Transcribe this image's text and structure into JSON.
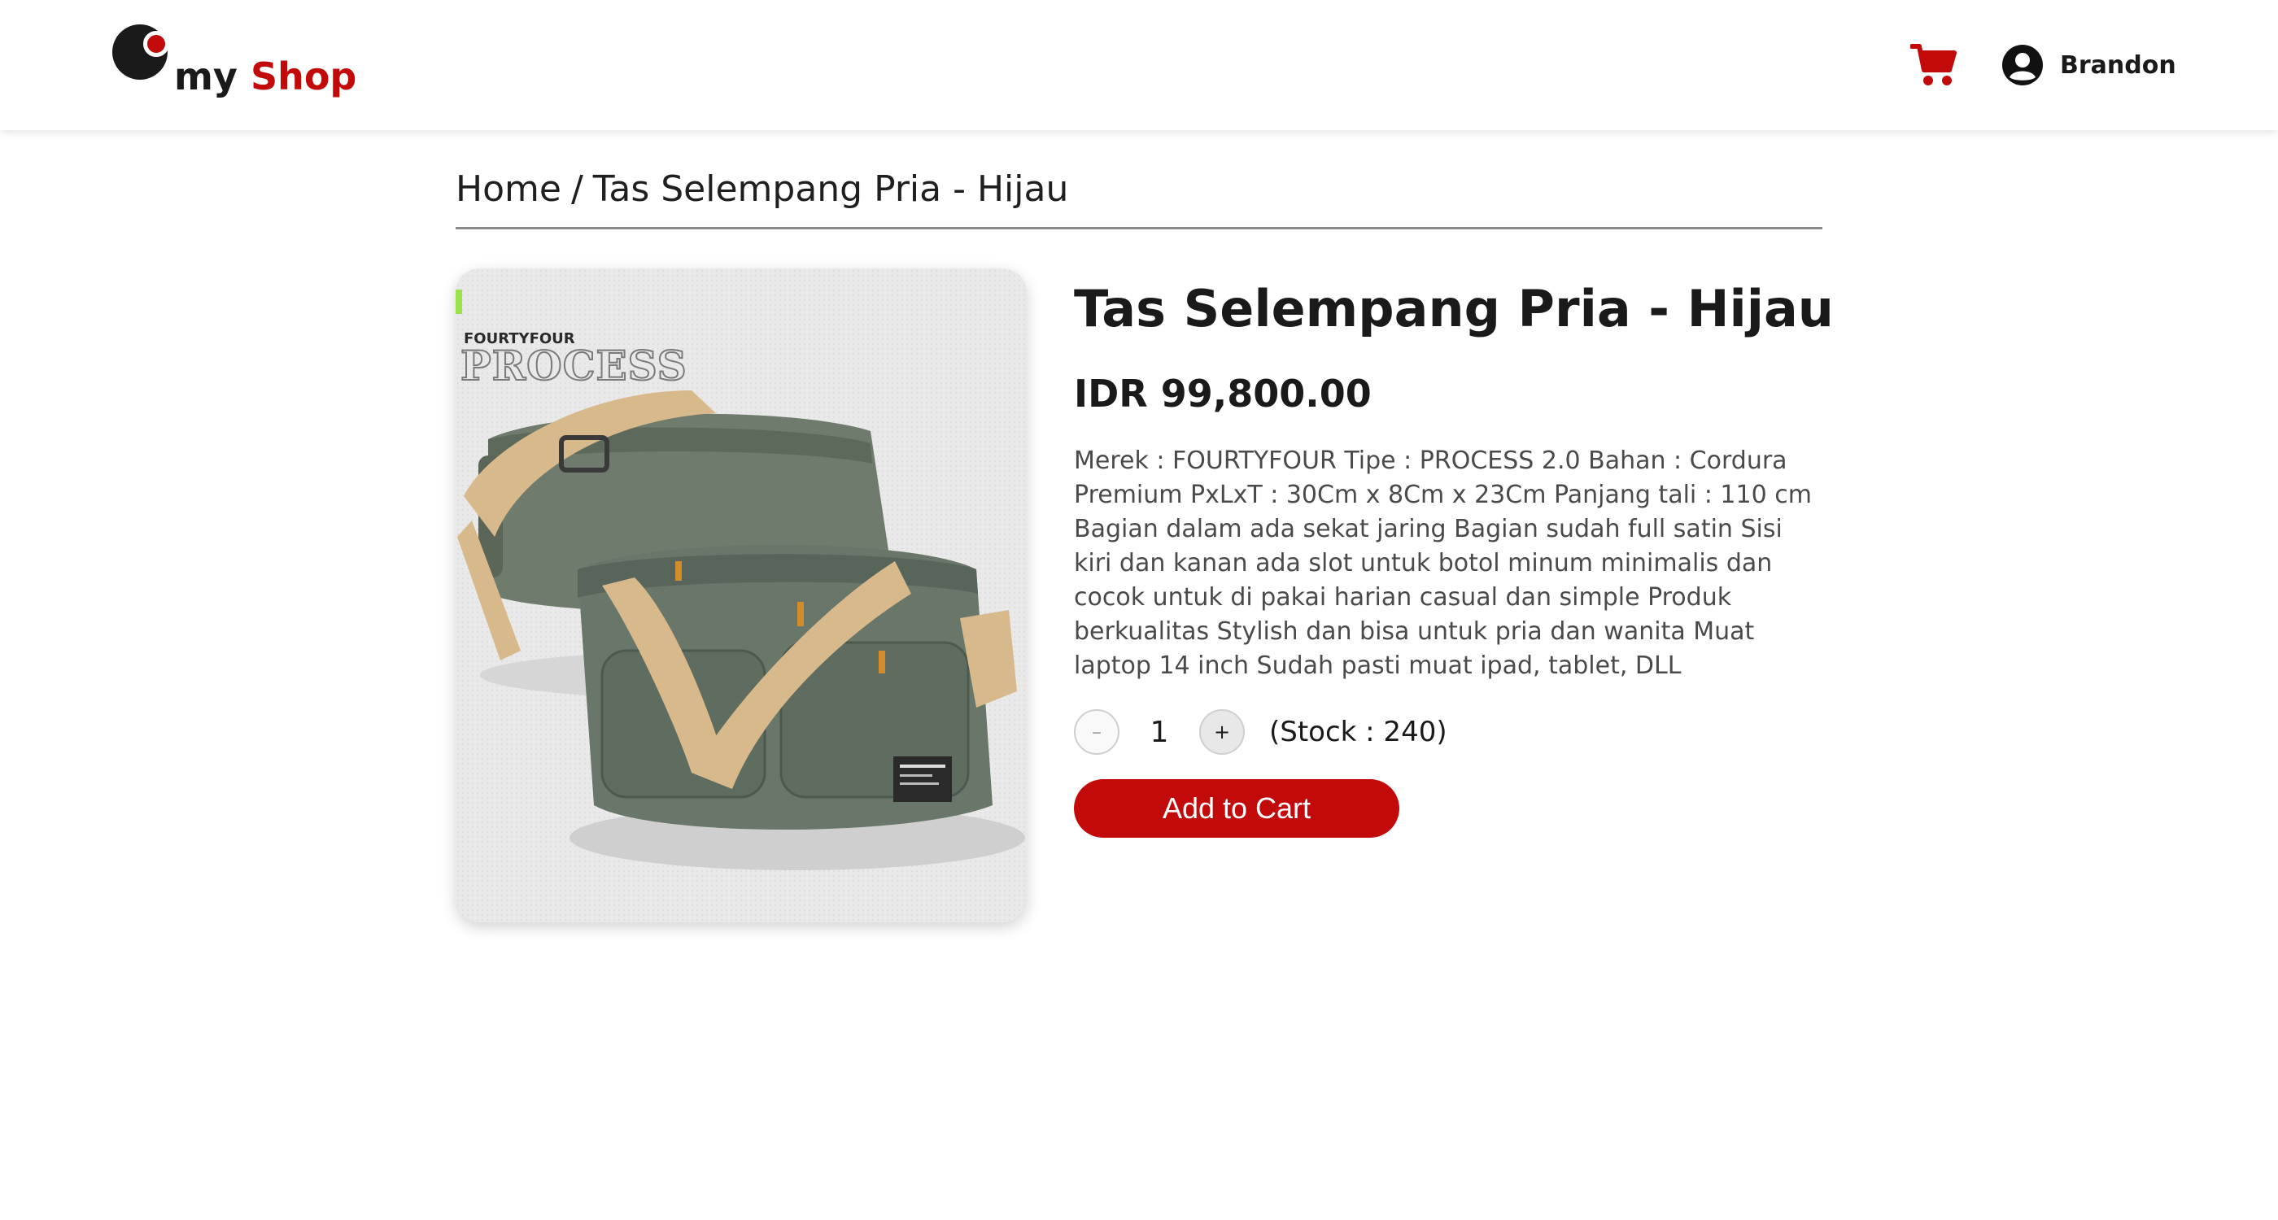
{
  "header": {
    "logo_my": "my",
    "logo_shop": "Shop",
    "cart_icon": "cart-icon",
    "user_icon": "user-circle-icon",
    "user_name": "Brandon"
  },
  "breadcrumb": {
    "home": "Home",
    "separator": "/",
    "current": "Tas Selempang Pria - Hijau"
  },
  "product": {
    "image_brand_small": "FOURTYFOUR",
    "image_brand_big": "PROCESS",
    "name": "Tas Selempang Pria - Hijau",
    "price": "IDR 99,800.00",
    "description": "Merek : FOURTYFOUR Tipe : PROCESS 2.0 Bahan : Cordura Premium PxLxT : 30Cm x 8Cm x 23Cm Panjang tali : 110 cm Bagian dalam ada sekat jaring Bagian sudah full satin Sisi kiri dan kanan ada slot untuk botol minum minimalis dan cocok untuk di pakai harian casual dan simple Produk berkualitas Stylish dan bisa untuk pria dan wanita Muat laptop 14 inch Sudah pasti muat ipad, tablet, DLL",
    "quantity": "1",
    "minus_label": "–",
    "plus_label": "+",
    "stock_text": "(Stock : 240)",
    "add_to_cart_label": "Add to Cart"
  },
  "colors": {
    "brand_red": "#c20a0a",
    "text_dark": "#1a1a1a",
    "text_muted": "#4a4a4a"
  }
}
